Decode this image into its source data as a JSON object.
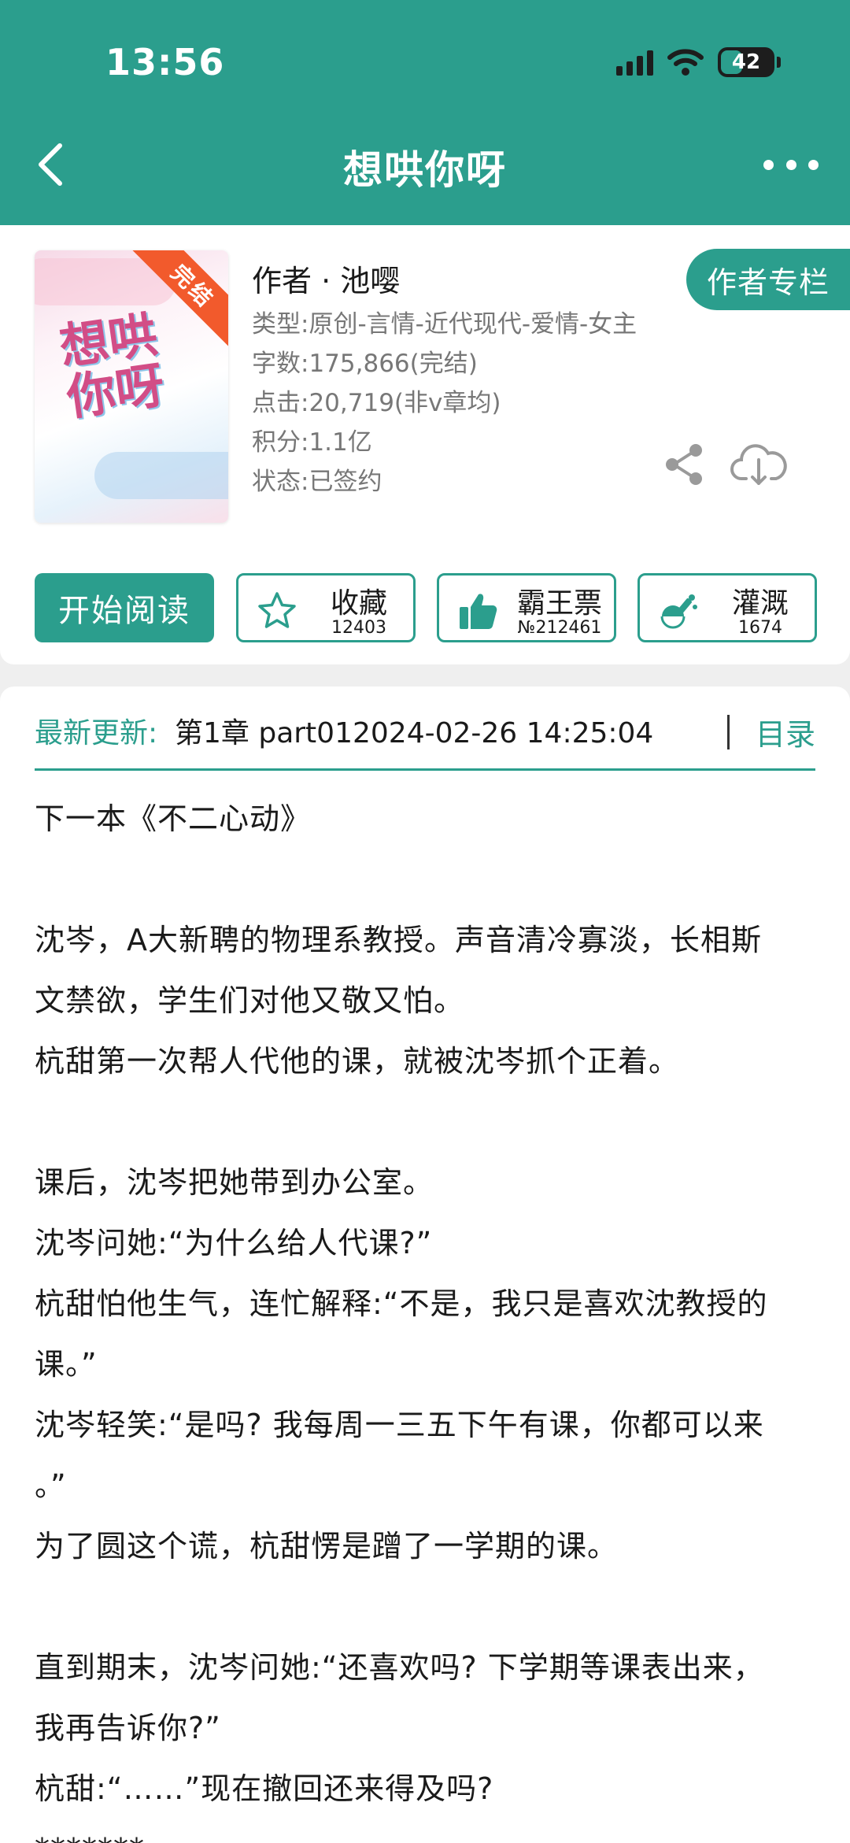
{
  "status_bar": {
    "time": "13:56",
    "battery": "42",
    "battery_level": 0.42
  },
  "nav": {
    "title": "想哄你呀"
  },
  "book": {
    "cover_title": "想哄你呀",
    "completed_badge": "完结",
    "author": "作者 · 池嘤",
    "author_column_button": "作者专栏",
    "type": "类型:原创-言情-近代现代-爱情-女主",
    "word_count": "字数:175,866(完结)",
    "clicks": "点击:20,719(非v章均)",
    "score": "积分:1.1亿",
    "status": "状态:已签约"
  },
  "actions": {
    "read_button": "开始阅读",
    "favorite": {
      "label": "收藏",
      "count": "12403"
    },
    "tyrant_ticket": {
      "label": "霸王票",
      "count": "№212461"
    },
    "irrigate": {
      "label": "灌溉",
      "count": "1674"
    }
  },
  "latest_update": {
    "label": "最新更新:",
    "text": "第1章 part012024-02-26 14:25:04",
    "toc_link": "目录"
  },
  "description": [
    "下一本《不二心动》",
    "",
    "沈岑，A大新聘的物理系教授。声音清冷寡淡，长相斯",
    "文禁欲，学生们对他又敬又怕。",
    "杭甜第一次帮人代他的课，就被沈岑抓个正着。",
    "",
    "课后，沈岑把她带到办公室。",
    "沈岑问她:“为什么给人代课?”",
    "杭甜怕他生气，连忙解释:“不是，我只是喜欢沈教授的",
    "课。”",
    "沈岑轻笑:“是吗? 我每周一三五下午有课，你都可以来",
    "。”",
    "为了圆这个谎，杭甜愣是蹭了一学期的课。",
    "",
    "直到期末，沈岑问她:“还喜欢吗? 下学期等课表出来，",
    "我再告诉你?”",
    "杭甜:“……”现在撤回还来得及吗?",
    "*******"
  ],
  "colors": {
    "brand": "#2b9e8d",
    "ribbon": "#f25a2c"
  }
}
